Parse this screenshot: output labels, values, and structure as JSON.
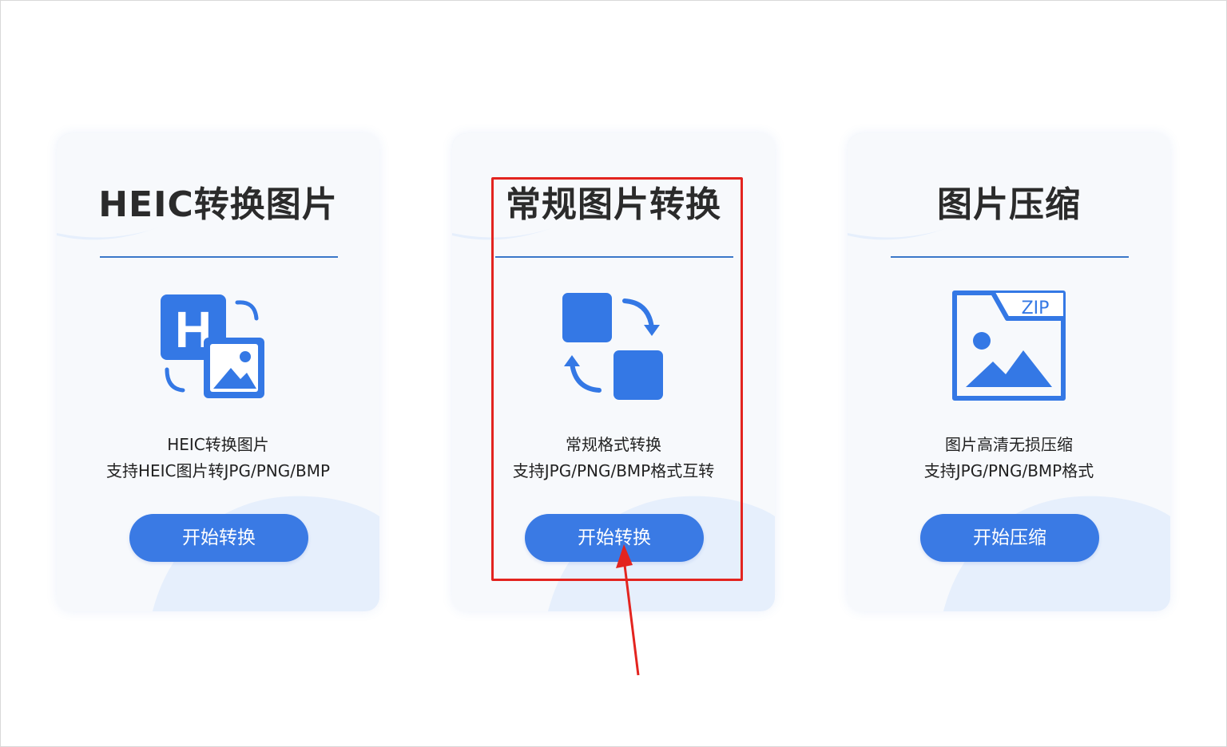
{
  "cards": [
    {
      "title": "HEIC转换图片",
      "desc_line1": "HEIC转换图片",
      "desc_line2": "支持HEIC图片转JPG/PNG/BMP",
      "button": "开始转换",
      "icon": "heic-image-icon"
    },
    {
      "title": "常规图片转换",
      "desc_line1": "常规格式转换",
      "desc_line2": "支持JPG/PNG/BMP格式互转",
      "button": "开始转换",
      "icon": "format-convert-icon"
    },
    {
      "title": "图片压缩",
      "desc_line1": "图片高清无损压缩",
      "desc_line2": "支持JPG/PNG/BMP格式",
      "button": "开始压缩",
      "icon": "zip-image-icon",
      "icon_label": "ZIP"
    }
  ],
  "colors": {
    "accent": "#3a7ae4",
    "icon_blue": "#3478e5",
    "divider": "#3b78c9",
    "highlight": "#e3241f",
    "card_bg": "#f7f9fc",
    "card_shape": "#e6effc"
  }
}
